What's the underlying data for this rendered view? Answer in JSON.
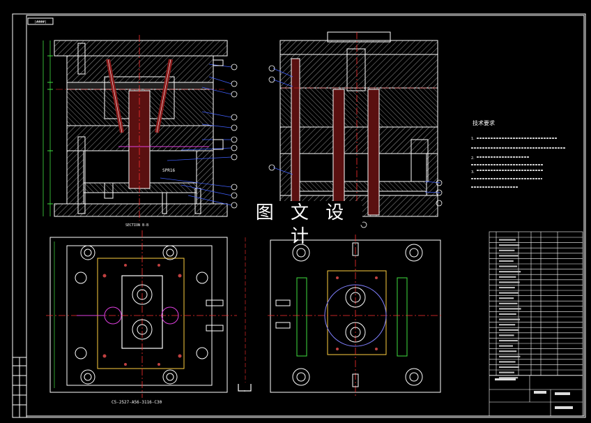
{
  "watermark": "图 文 设 计",
  "section_label": "SECTION B-B",
  "tech_req": {
    "title": "技术要求",
    "lines": [
      "1.",
      "",
      "2.",
      "",
      "3.",
      "",
      ""
    ]
  },
  "part_tag": "SPR16",
  "bottom_note": "C5-2527-A56-3116-C30",
  "colors": {
    "background": "#000000",
    "border": "#ffffff",
    "plate_hatch": "#c0c0c0",
    "centerline": "#ff3030",
    "cooling": "#e040e0",
    "dimension": "#40e040",
    "leader": "#4060ff",
    "part_fill": "#8a1a1a",
    "ejector": "#ffd040"
  },
  "icons": [
    "balloon-callout-icon",
    "section-arrow-icon"
  ]
}
